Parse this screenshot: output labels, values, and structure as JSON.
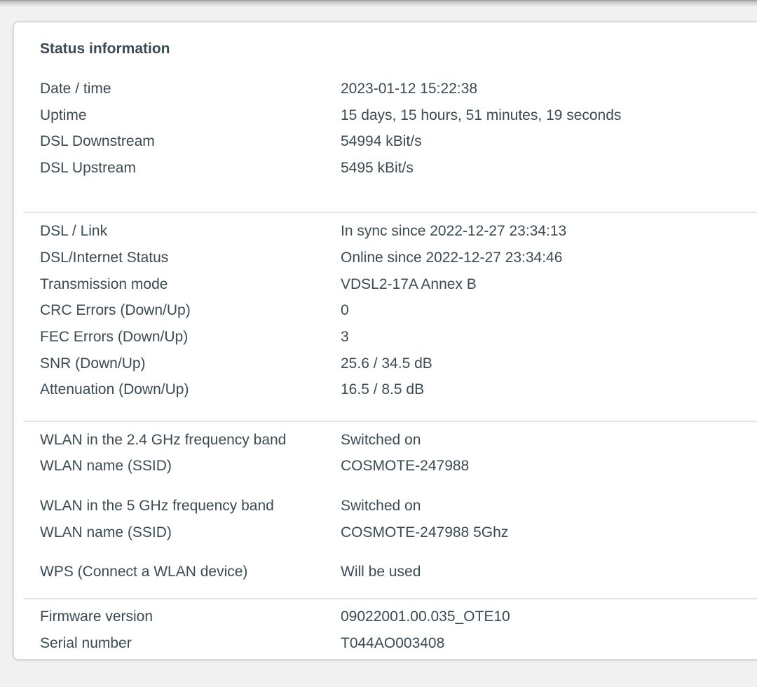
{
  "panel": {
    "title": "Status information"
  },
  "sections": [
    {
      "rows": [
        {
          "label": "Date / time",
          "value": "2023-01-12 15:22:38"
        },
        {
          "label": "Uptime",
          "value": "15 days, 15 hours, 51 minutes, 19 seconds"
        },
        {
          "label": "DSL Downstream",
          "value": "54994 kBit/s"
        },
        {
          "label": "DSL Upstream",
          "value": "5495 kBit/s"
        }
      ]
    },
    {
      "rows": [
        {
          "label": "DSL / Link",
          "value": "In sync since 2022-12-27 23:34:13"
        },
        {
          "label": "DSL/Internet Status",
          "value": "Online since 2022-12-27 23:34:46"
        },
        {
          "label": "Transmission mode",
          "value": "VDSL2-17A Annex B"
        },
        {
          "label": "CRC Errors (Down/Up)",
          "value": "0"
        },
        {
          "label": "FEC Errors (Down/Up)",
          "value": "3"
        },
        {
          "label": "SNR (Down/Up)",
          "value": "25.6 / 34.5 dB"
        },
        {
          "label": "Attenuation (Down/Up)",
          "value": "16.5 / 8.5 dB"
        }
      ]
    },
    {
      "rows": [
        {
          "label": "WLAN in the 2.4 GHz frequency band",
          "value": "Switched on"
        },
        {
          "label": "WLAN name (SSID)",
          "value": "COSMOTE-247988"
        },
        {
          "label": "WLAN in the 5 GHz frequency band",
          "value": "Switched on"
        },
        {
          "label": "WLAN name (SSID)",
          "value": "COSMOTE-247988 5Ghz"
        },
        {
          "label": "WPS (Connect a WLAN device)",
          "value": "Will be used"
        }
      ]
    },
    {
      "rows": [
        {
          "label": "Firmware version",
          "value": "09022001.00.035_OTE10"
        },
        {
          "label": "Serial number",
          "value": "T044AO003408"
        }
      ]
    }
  ]
}
